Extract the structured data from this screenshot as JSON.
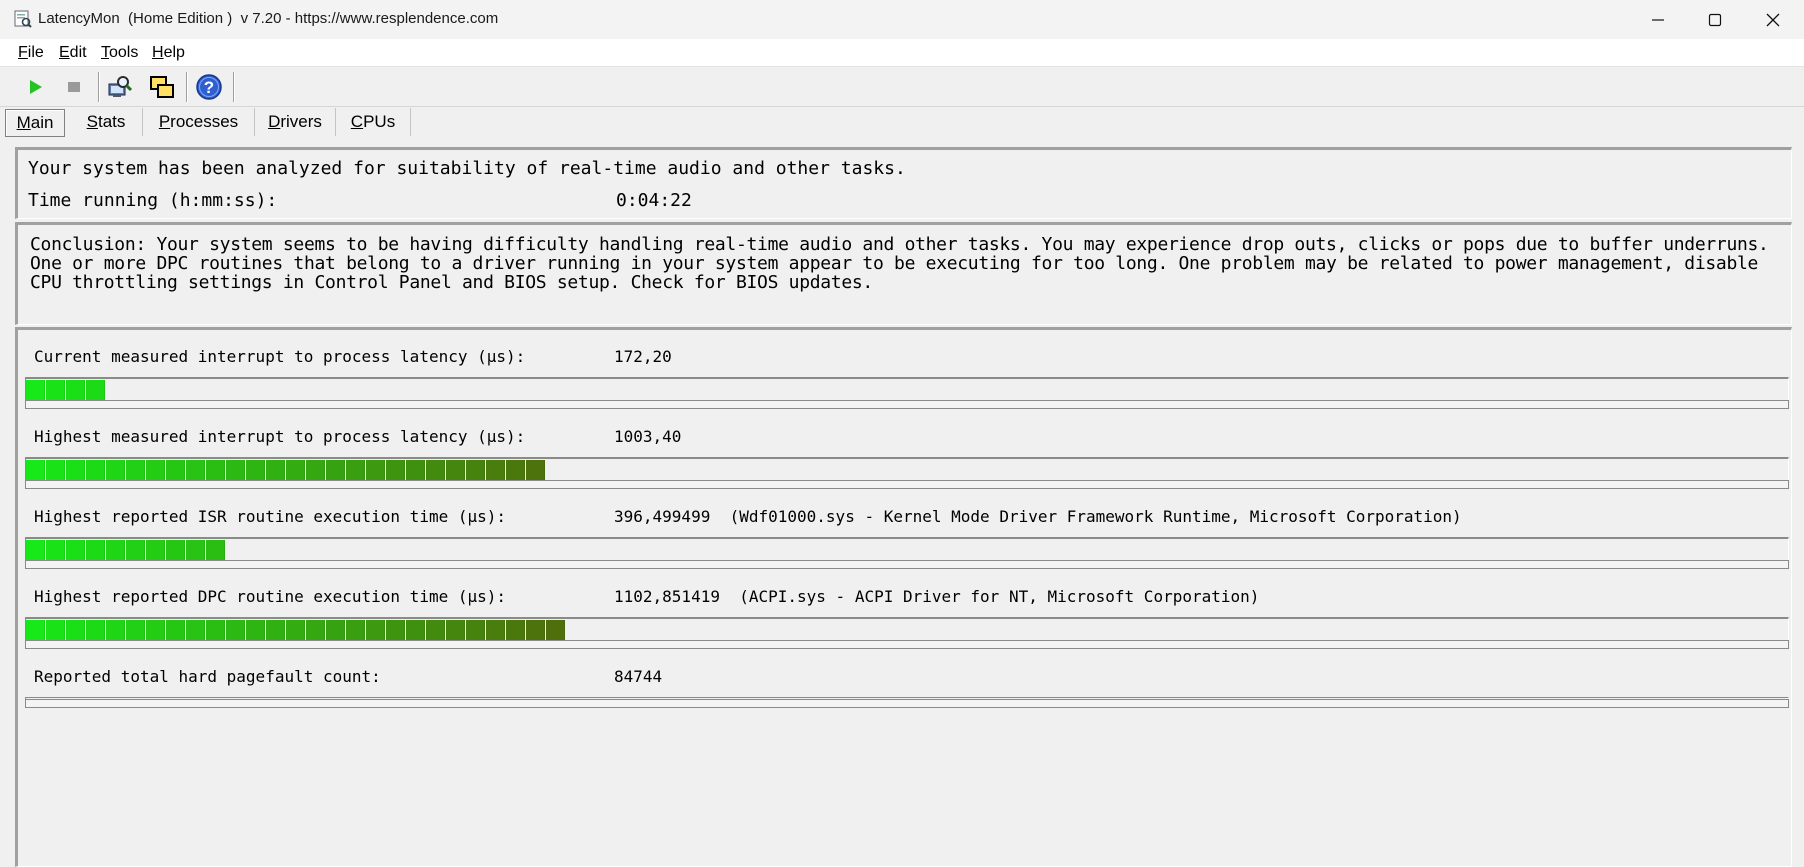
{
  "window": {
    "title": "LatencyMon  (Home Edition )  v 7.20 - https://www.resplendence.com"
  },
  "menu": {
    "items": [
      {
        "key": "F",
        "rest": "ile"
      },
      {
        "key": "E",
        "rest": "dit"
      },
      {
        "key": "T",
        "rest": "ools"
      },
      {
        "key": "H",
        "rest": "elp"
      }
    ]
  },
  "toolbar": {
    "buttons": [
      "play-icon",
      "stop-icon",
      "magnifier-computer-icon",
      "windows-cascade-icon",
      "help-icon"
    ]
  },
  "tabs": [
    {
      "key": "M",
      "rest": "ain",
      "active": true
    },
    {
      "key": "S",
      "rest": "tats",
      "active": false
    },
    {
      "key": "P",
      "rest": "rocesses",
      "active": false
    },
    {
      "key": "D",
      "rest": "rivers",
      "active": false
    },
    {
      "key": "C",
      "rest": "PUs",
      "active": false
    }
  ],
  "summary": {
    "analysis": "Your system has been analyzed for suitability of real-time audio and other tasks.",
    "time_label": "Time running (h:mm:ss):",
    "time_value": "0:04:22"
  },
  "conclusion": "Conclusion: Your system seems to be having difficulty handling real-time audio and other tasks. You may experience drop outs, clicks or pops due to buffer underruns. One or more DPC routines that belong to a driver running in your system appear to be executing for too long. One problem may be related to power management, disable CPU throttling settings in Control Panel and BIOS setup. Check for BIOS updates.",
  "metrics": [
    {
      "label": "Current measured interrupt to process latency (µs):",
      "value": "172,20",
      "bar_segments": 4
    },
    {
      "label": "Highest measured interrupt to process latency (µs):",
      "value": "1003,40",
      "bar_segments": 26
    },
    {
      "label": "Highest reported ISR routine execution time (µs):",
      "value": "396,499499  (Wdf01000.sys - Kernel Mode Driver Framework Runtime, Microsoft Corporation)",
      "bar_segments": 10
    },
    {
      "label": "Highest reported DPC routine execution time (µs):",
      "value": "1102,851419  (ACPI.sys - ACPI Driver for NT, Microsoft Corporation)",
      "bar_segments": 27
    },
    {
      "label": "Reported total hard pagefault count:",
      "value": "84744",
      "bar_segments": 0
    }
  ],
  "colors": {
    "bar_start": "#17e817",
    "bar_end": "#4f6f0c"
  }
}
